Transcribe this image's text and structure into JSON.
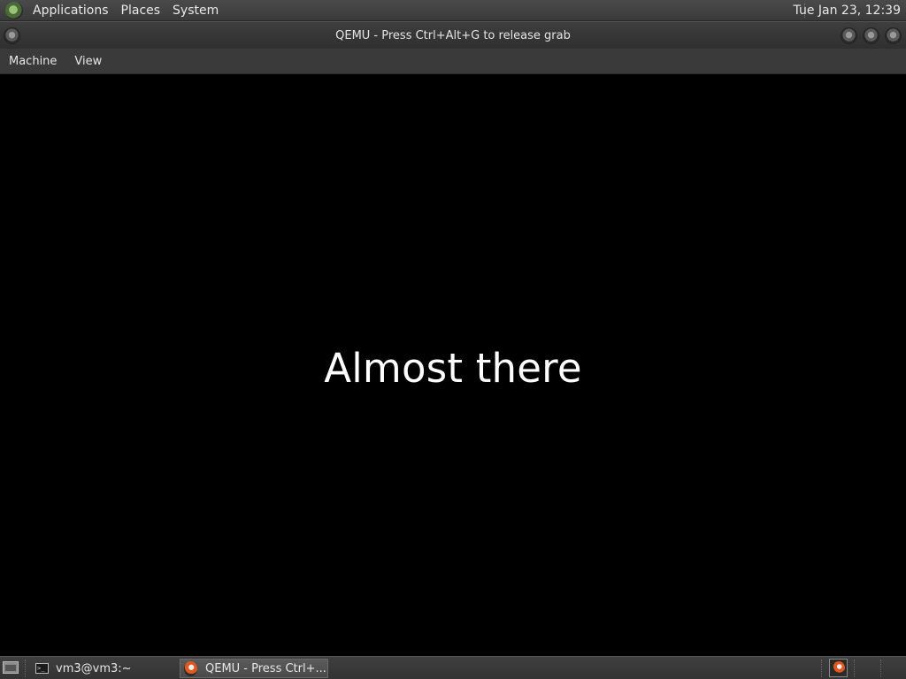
{
  "top_panel": {
    "menus": [
      "Applications",
      "Places",
      "System"
    ],
    "clock": "Tue Jan 23, 12:39"
  },
  "window": {
    "title": "QEMU - Press Ctrl+Alt+G to release grab",
    "menus": [
      "Machine",
      "View"
    ]
  },
  "vm_screen": {
    "message": "Almost there",
    "background": "#000000",
    "text_color": "#ffffff"
  },
  "taskbar": {
    "tasks": [
      {
        "label": "vm3@vm3:~",
        "icon": "terminal-icon"
      },
      {
        "label": "QEMU - Press Ctrl+...",
        "icon": "qemu-icon",
        "active": true
      }
    ],
    "tray_icon": "qemu-icon"
  }
}
